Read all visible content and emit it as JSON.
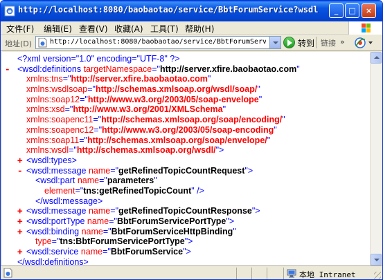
{
  "window": {
    "title": "http://localhost:8080/baobaotao/service/BbtForumService?wsdl -..."
  },
  "menu": {
    "items": [
      "文件(F)",
      "编辑(E)",
      "查看(V)",
      "收藏(A)",
      "工具(T)",
      "帮助(H)"
    ]
  },
  "address": {
    "label": "地址(D)",
    "url": "http://localhost:8080/baobaotao/service/BbtForumService?wsdl",
    "go_label": "转到",
    "links_label": "链接",
    "links_more": "»"
  },
  "xml": {
    "decl": "<?xml version=\"1.0\" encoding=\"UTF-8\" ?>",
    "def_toggle": "-",
    "def_open": "<wsdl:definitions",
    "def_attr": "targetNamespace",
    "def_val": "http://server.xfire.baobaotao.com",
    "ns": [
      {
        "name": "xmlns:tns",
        "value": "http://server.xfire.baobaotao.com"
      },
      {
        "name": "xmlns:wsdlsoap",
        "value": "http://schemas.xmlsoap.org/wsdl/soap/"
      },
      {
        "name": "xmlns:soap12",
        "value": "http://www.w3.org/2003/05/soap-envelope"
      },
      {
        "name": "xmlns:xsd",
        "value": "http://www.w3.org/2001/XMLSchema"
      },
      {
        "name": "xmlns:soapenc11",
        "value": "http://schemas.xmlsoap.org/soap/encoding/"
      },
      {
        "name": "xmlns:soapenc12",
        "value": "http://www.w3.org/2003/05/soap-encoding"
      },
      {
        "name": "xmlns:soap11",
        "value": "http://schemas.xmlsoap.org/soap/envelope/"
      },
      {
        "name": "xmlns:wsdl",
        "value": "http://schemas.xmlsoap.org/wsdl/"
      }
    ],
    "types": {
      "toggle": "+",
      "tag": "<wsdl:types>"
    },
    "message1": {
      "toggle": "-",
      "open": "<wsdl:message",
      "attr": "name",
      "value": "getRefinedTopicCountRequest"
    },
    "part": {
      "open": "<wsdl:part",
      "attr": "name",
      "value": "parameters",
      "attr2": "element",
      "value2": "tns:getRefinedTopicCount",
      "close": "/>"
    },
    "message1_close": "</wsdl:message>",
    "message2": {
      "toggle": "+",
      "open": "<wsdl:message",
      "attr": "name",
      "value": "getRefinedTopicCountResponse"
    },
    "porttype": {
      "toggle": "+",
      "open": "<wsdl:portType",
      "attr": "name",
      "value": "BbtForumServicePortType"
    },
    "binding": {
      "toggle": "+",
      "open": "<wsdl:binding",
      "attr": "name",
      "value": "BbtForumServiceHttpBinding",
      "attr2": "type",
      "value2": "tns:BbtForumServicePortType"
    },
    "service": {
      "toggle": "+",
      "open": "<wsdl:service",
      "attr": "name",
      "value": "BbtForumService"
    },
    "def_close": "</wsdl:definitions>"
  },
  "status": {
    "zone_text": "本地 Intranet"
  },
  "colors": {
    "titlebar": "#0a56e3",
    "tag_blue": "#0000ff",
    "attr_red": "#ff0000",
    "chrome": "#ece9d8"
  }
}
